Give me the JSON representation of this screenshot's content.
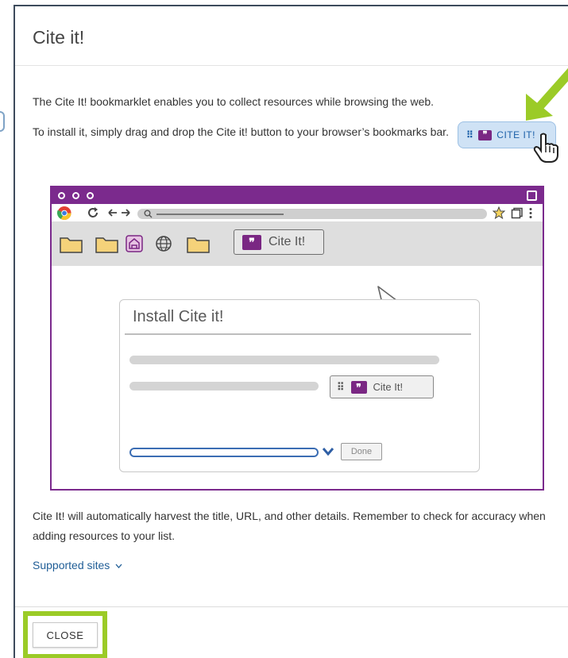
{
  "modal": {
    "title": "Cite it!",
    "intro": "The Cite It! bookmarklet enables you to collect resources while browsing the web.",
    "install_text": "To install it, simply drag and drop the Cite it! button to your browser’s bookmarks bar.",
    "bookmarklet_button": {
      "label": "CITE IT!",
      "grip": "⠿",
      "quote": "❞"
    },
    "illustration": {
      "bookmark_button": "Cite It!",
      "install_panel_title": "Install Cite it!",
      "install_panel_button": "Cite It!",
      "done_button": "Done"
    },
    "harvest_text": "Cite It! will automatically harvest the title, URL, and other details. Remember to check for accuracy when adding resources to your list.",
    "supported_sites": "Supported sites",
    "close_label": "CLOSE"
  },
  "colors": {
    "accent_purple": "#7b2a8d",
    "highlight_green": "#9bcb27",
    "link_blue": "#1f5d96",
    "button_blue_bg": "#cfe2f5"
  },
  "icons": [
    "grip-icon",
    "quote-icon",
    "hand-cursor-icon",
    "green-arrow-icon",
    "chrome-icon",
    "reload-icon",
    "star-icon",
    "folder-icon",
    "globe-icon",
    "pointer-cursor-icon",
    "chevron-down-icon"
  ]
}
